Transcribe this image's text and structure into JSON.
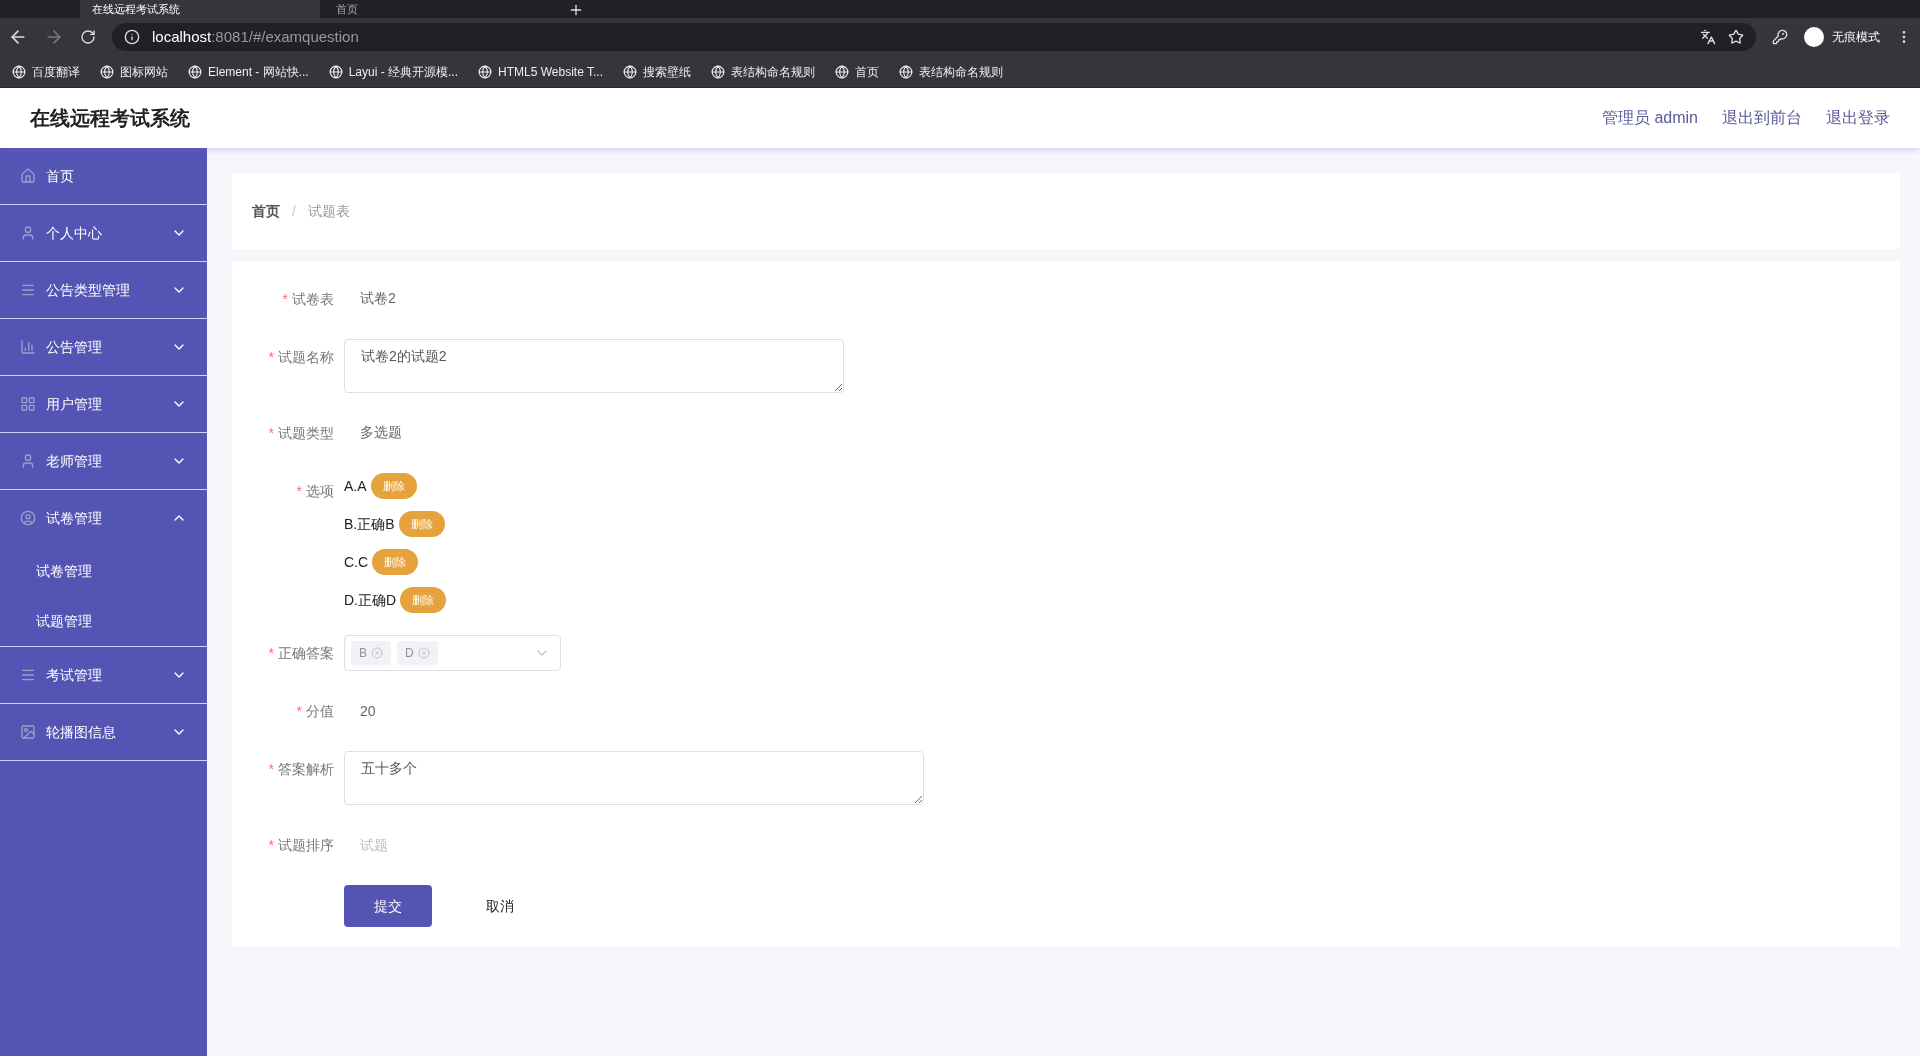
{
  "browser": {
    "tabs": [
      {
        "title": "在线远程考试系统",
        "selected": true
      },
      {
        "title": "首页",
        "selected": false
      }
    ],
    "url_host": "localhost",
    "url_rest": ":8081/#/examquestion",
    "bookmarks": [
      "百度翻译",
      "图标网站",
      "Element - 网站快...",
      "Layui - 经典开源模...",
      "HTML5 Website T...",
      "搜索壁纸",
      "表结构命名规则",
      "首页",
      "表结构命名规则"
    ],
    "profile": "无痕模式"
  },
  "header": {
    "title": "在线远程考试系统",
    "links": [
      "管理员 admin",
      "退出到前台",
      "退出登录"
    ]
  },
  "sidebar": {
    "items": [
      {
        "label": "首页",
        "kind": "link"
      },
      {
        "label": "个人中心",
        "kind": "group",
        "expanded": false
      },
      {
        "label": "公告类型管理",
        "kind": "group",
        "expanded": false
      },
      {
        "label": "公告管理",
        "kind": "group",
        "expanded": false
      },
      {
        "label": "用户管理",
        "kind": "group",
        "expanded": false
      },
      {
        "label": "老师管理",
        "kind": "group",
        "expanded": false
      },
      {
        "label": "试卷管理",
        "kind": "group",
        "expanded": true,
        "children": [
          {
            "label": "试卷管理"
          },
          {
            "label": "试题管理"
          }
        ]
      },
      {
        "label": "考试管理",
        "kind": "group",
        "expanded": false
      },
      {
        "label": "轮播图信息",
        "kind": "group",
        "expanded": false
      }
    ]
  },
  "breadcrumb": {
    "items": [
      "首页",
      "试题表"
    ],
    "separator": "/"
  },
  "form": {
    "fields": [
      {
        "required_mark": "*",
        "label": "试卷表",
        "kind": "text",
        "value": "试卷2"
      },
      {
        "required_mark": "*",
        "label": "试题名称",
        "kind": "textarea",
        "value": "试卷2的试题2"
      },
      {
        "required_mark": "*",
        "label": "试题类型",
        "kind": "text",
        "value": "多选题"
      },
      {
        "required_mark": "*",
        "label": "选项",
        "kind": "options",
        "options": [
          {
            "text": "A.A",
            "delete_label": "删除"
          },
          {
            "text": "B.正确B",
            "delete_label": "删除"
          },
          {
            "text": "C.C",
            "delete_label": "删除"
          },
          {
            "text": "D.正确D",
            "delete_label": "删除"
          }
        ]
      },
      {
        "required_mark": "*",
        "label": "正确答案",
        "kind": "multiselect",
        "tags": [
          "B",
          "D"
        ]
      },
      {
        "required_mark": "*",
        "label": "分值",
        "kind": "text",
        "value": "20"
      },
      {
        "required_mark": "*",
        "label": "答案解析",
        "kind": "textarea",
        "value": "五十多个"
      },
      {
        "required_mark": "*",
        "label": "试题排序",
        "kind": "text",
        "placeholder": "试题"
      }
    ],
    "submit": "提交",
    "cancel": "取消"
  }
}
